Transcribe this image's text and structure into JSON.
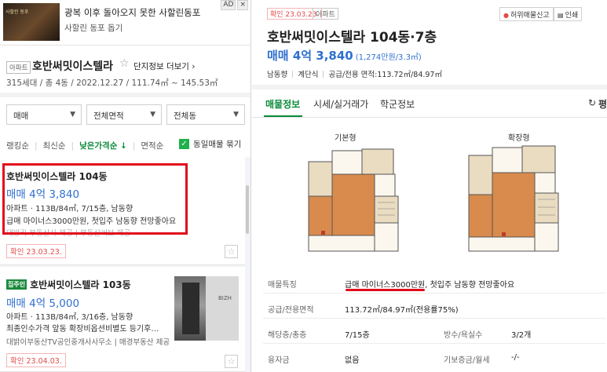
{
  "ad": {
    "title": "광복 이후 돌아오지 못한 사할린동포",
    "subtitle": "사할린 동포 돕기",
    "thumb_text": "사할린 동포",
    "badge_ad": "AD",
    "badge_x": "×"
  },
  "complex": {
    "type_tag": "아파트",
    "name": "호반써밋이스텔라",
    "star": "☆",
    "more_link": "단지정보 더보기 ›",
    "info": "315세대 / 총 4동 / 2022.12.27 / 111.74㎡ ~ 145.53㎡"
  },
  "filters": [
    {
      "label": "매매"
    },
    {
      "label": "전체면적"
    },
    {
      "label": "전체동"
    }
  ],
  "sort": {
    "options": [
      "랭킹순",
      "최신순",
      "낮은가격순 ↓",
      "면적순"
    ],
    "active_index": 2,
    "same_listing_label": "동일매물 묶기",
    "same_listing_checked": true
  },
  "listings": [
    {
      "title": "호반써밋이스텔라 104동",
      "price": "매매 4억 3,840",
      "spec": "아파트 · 113B/84㎡, 7/15층, 남동향",
      "desc": "급매 마이너스3000만원, 첫입주 남동향 전망좋아요",
      "agent": "대방리 부동산사 제공  |  부동산써브 제공",
      "confirm": "확인 23.03.23."
    },
    {
      "tag": "집주인",
      "title": "호반써밋이스텔라 103동",
      "price": "매매 4억 5,000",
      "spec": "아파트 · 113B/84㎡, 3/16층, 남동향",
      "desc": "최종인수가격 앞동 확장비옵션비별도 등기후…",
      "agent": "대밝이부동산TV공인중개사사무소  |  매경부동산 제공",
      "confirm": "확인 23.04.03.",
      "photo_logo": "BIZH"
    }
  ],
  "detail": {
    "confirm": "확인 23.03.23.",
    "type_tag": "아파트",
    "report_btn": "허위매물신고",
    "print_btn": "인쇄",
    "title": "호반써밋이스텔라 104동·7층",
    "price": "매매 4억 3,840",
    "price_per": "(1,274만원/3.3㎡)",
    "meta": [
      "남동향",
      "계단식",
      "공급/전용 면적:113.72㎡/84.97㎡"
    ],
    "tabs": [
      "매물정보",
      "시세/실거래가",
      "학군정보"
    ],
    "active_tab": 0,
    "refresh_label": "평",
    "plans": [
      "기본형",
      "확장형"
    ],
    "rows": [
      {
        "k": "매물특징",
        "v": "급매 마이너스3000만원, 첫입주 남동향 전망좋아요"
      },
      {
        "k": "공급/전용면적",
        "v": "113.72㎡/84.97㎡(전용률75%)"
      },
      {
        "k": "해당층/총층",
        "v": "7/15층",
        "k2": "방수/욕실수",
        "v2": "3/2개"
      },
      {
        "k": "융자금",
        "v": "없음",
        "k2": "기보증금/월세",
        "v2": "-/-"
      }
    ]
  }
}
